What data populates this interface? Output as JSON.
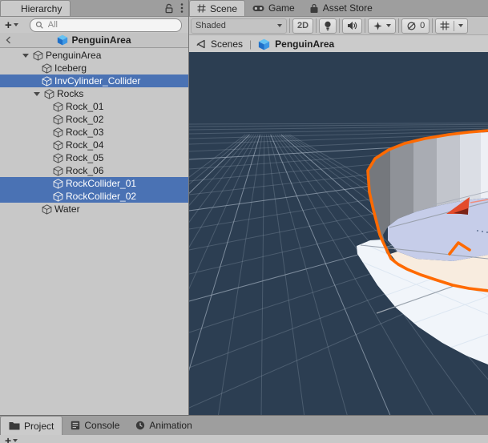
{
  "hierarchy": {
    "tab_label": "Hierarchy",
    "add_button": "+",
    "search_placeholder": "All",
    "prefab_header": {
      "root_name": "PenguinArea"
    },
    "tree": [
      {
        "label": "PenguinArea",
        "depth": 0,
        "expanded": true,
        "selected": false
      },
      {
        "label": "Iceberg",
        "depth": 1,
        "expanded": false,
        "selected": false
      },
      {
        "label": "InvCylinder_Collider",
        "depth": 1,
        "expanded": false,
        "selected": true
      },
      {
        "label": "Rocks",
        "depth": 1,
        "expanded": true,
        "selected": false
      },
      {
        "label": "Rock_01",
        "depth": 2,
        "expanded": false,
        "selected": false
      },
      {
        "label": "Rock_02",
        "depth": 2,
        "expanded": false,
        "selected": false
      },
      {
        "label": "Rock_03",
        "depth": 2,
        "expanded": false,
        "selected": false
      },
      {
        "label": "Rock_04",
        "depth": 2,
        "expanded": false,
        "selected": false
      },
      {
        "label": "Rock_05",
        "depth": 2,
        "expanded": false,
        "selected": false
      },
      {
        "label": "Rock_06",
        "depth": 2,
        "expanded": false,
        "selected": false
      },
      {
        "label": "RockCollider_01",
        "depth": 2,
        "expanded": false,
        "selected": true
      },
      {
        "label": "RockCollider_02",
        "depth": 2,
        "expanded": false,
        "selected": true
      },
      {
        "label": "Water",
        "depth": 1,
        "expanded": false,
        "selected": false
      }
    ]
  },
  "scene_view": {
    "tabs": [
      {
        "label": "Scene",
        "active": true
      },
      {
        "label": "Game",
        "active": false
      },
      {
        "label": "Asset Store",
        "active": false
      }
    ],
    "toolbar": {
      "shading": "Shaded",
      "toggle_2d": "2D",
      "hidden_count": "0"
    },
    "breadcrumb": {
      "back_label": "Scenes",
      "separator": "|",
      "current": "PenguinArea"
    }
  },
  "bottom_tabs": [
    {
      "label": "Project",
      "active": true
    },
    {
      "label": "Console",
      "active": false
    },
    {
      "label": "Animation",
      "active": false
    }
  ],
  "project_panel": {
    "add_button": "+"
  },
  "colors": {
    "selection_blue": "#4a72b4",
    "scene_background": "#2c3e52",
    "selection_outline_orange": "#ff6a00",
    "panel_gray": "#c8c8c8",
    "iceberg_top": "#c6cde9",
    "iceberg_cream": "#f8ecdf",
    "iceberg_white": "#f1f5fa",
    "gizmo_red": "#e34b2c"
  }
}
